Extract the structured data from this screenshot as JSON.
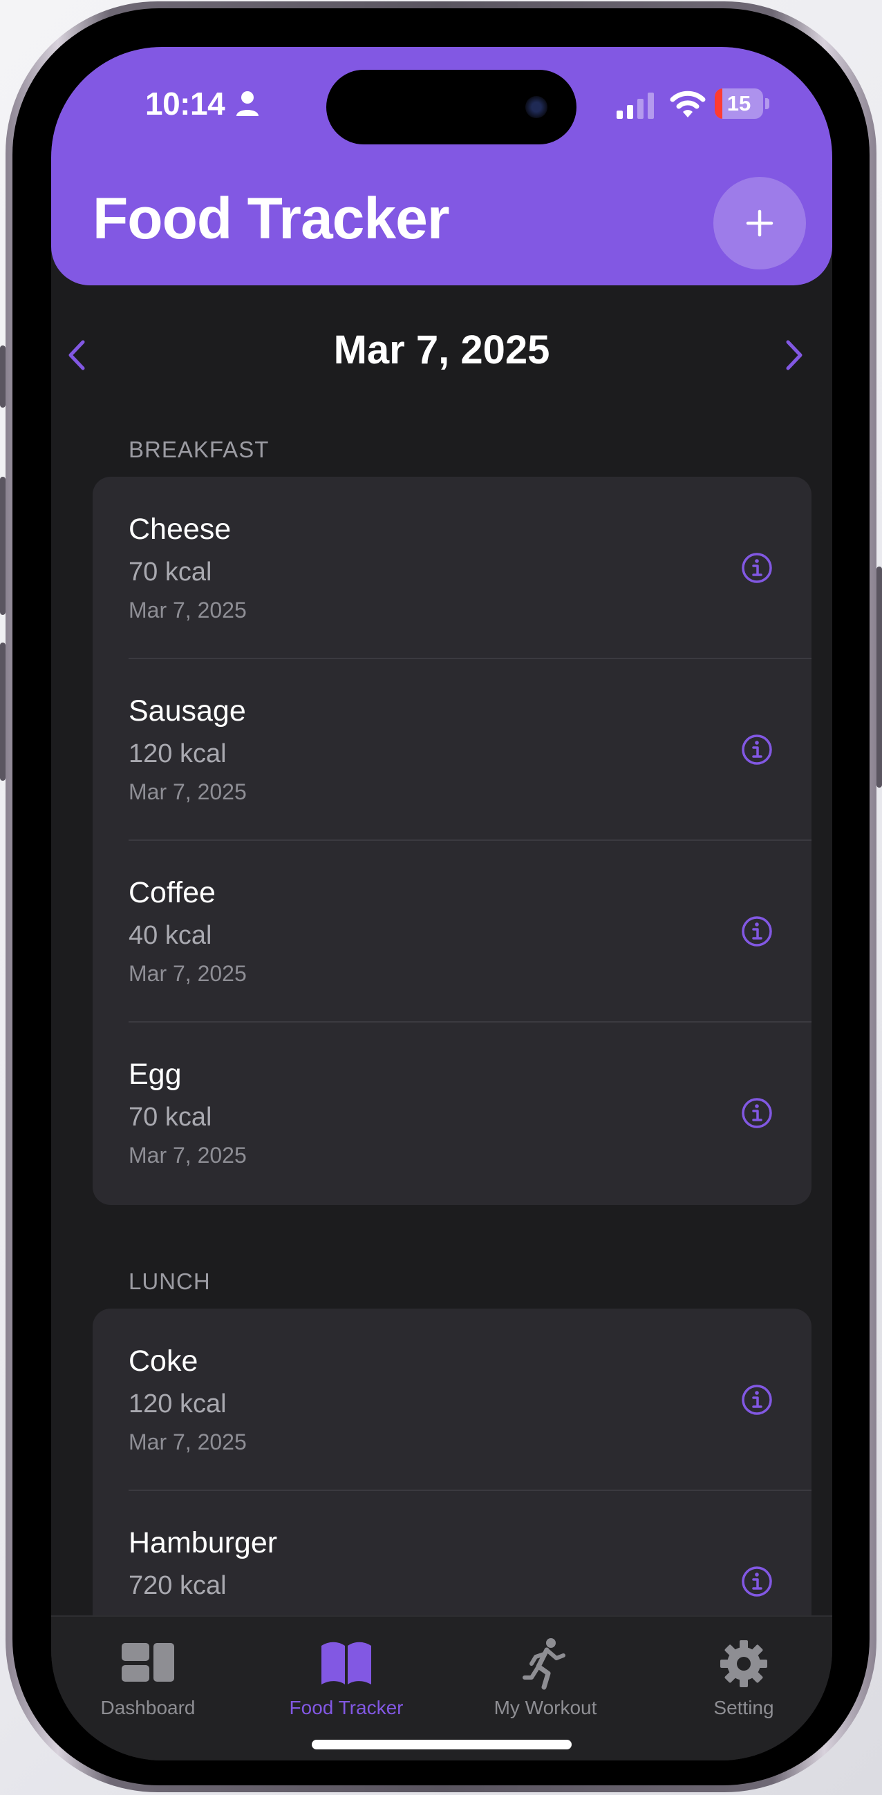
{
  "status_bar": {
    "time": "10:14",
    "battery": "15",
    "battery_level": 0.15
  },
  "header": {
    "title": "Food Tracker",
    "add_icon": "plus-icon"
  },
  "date_nav": {
    "date": "Mar 7, 2025",
    "prev_icon": "chevron-left-icon",
    "next_icon": "chevron-right-icon"
  },
  "sections": [
    {
      "title": "BREAKFAST",
      "items": [
        {
          "name": "Cheese",
          "kcal": "70 kcal",
          "date": "Mar 7, 2025"
        },
        {
          "name": "Sausage",
          "kcal": "120 kcal",
          "date": "Mar 7, 2025"
        },
        {
          "name": "Coffee",
          "kcal": "40 kcal",
          "date": "Mar 7, 2025"
        },
        {
          "name": "Egg",
          "kcal": "70 kcal",
          "date": "Mar 7, 2025"
        }
      ]
    },
    {
      "title": "LUNCH",
      "items": [
        {
          "name": "Coke",
          "kcal": "120 kcal",
          "date": "Mar 7, 2025"
        },
        {
          "name": "Hamburger",
          "kcal": "720 kcal",
          "date": ""
        }
      ]
    }
  ],
  "tabs": [
    {
      "label": "Dashboard",
      "icon": "dashboard-icon",
      "active": false
    },
    {
      "label": "Food Tracker",
      "icon": "book-icon",
      "active": true
    },
    {
      "label": "My Workout",
      "icon": "running-icon",
      "active": false
    },
    {
      "label": "Setting",
      "icon": "gear-icon",
      "active": false
    }
  ],
  "colors": {
    "accent": "#8258e3",
    "background": "#1c1c1e",
    "card": "#2b2a2f",
    "tabbar": "#222224"
  }
}
